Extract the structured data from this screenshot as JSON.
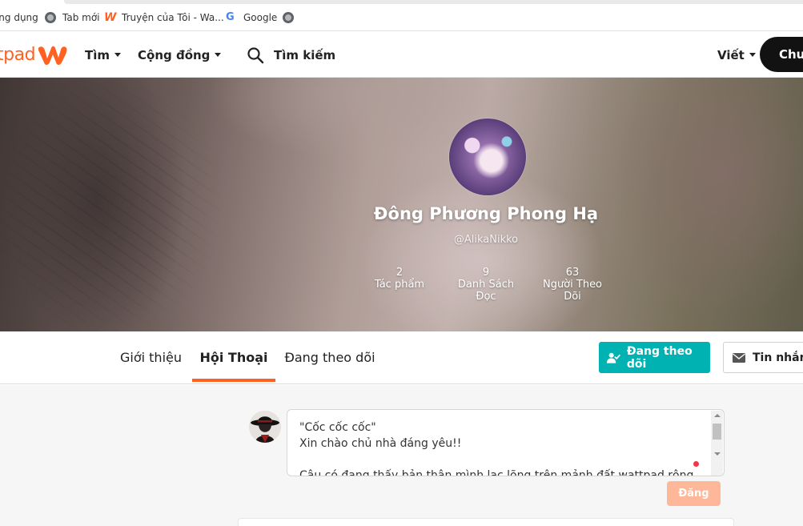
{
  "bookmarks": [
    {
      "label": "Ứng dụng",
      "icon": "apps-icon"
    },
    {
      "label": "Tab mới",
      "icon": "globe-icon"
    },
    {
      "label": "Truyện của Tôi - Wa...",
      "icon": "wattpad-icon"
    },
    {
      "label": "Google",
      "icon": "google-icon"
    },
    {
      "label": "",
      "icon": "globe-icon"
    }
  ],
  "header": {
    "logo_text": "tpad",
    "nav": {
      "browse": "Tìm",
      "community": "Cộng đồng"
    },
    "search_placeholder": "Tìm kiếm",
    "write": "Viết",
    "premium": "Chuy"
  },
  "profile": {
    "display_name": "Đông Phương Phong Hạ",
    "username": "@AlikaNikko",
    "stats": [
      {
        "value": "2",
        "label": "Tác phẩm"
      },
      {
        "value": "9",
        "label": "Danh Sách Đọc"
      },
      {
        "value": "63",
        "label": "Người Theo Dõi"
      }
    ]
  },
  "tabs": {
    "about": "Giới thiệu",
    "conversations": "Hội Thoại",
    "following": "Đang theo dõi",
    "active": "conversations"
  },
  "actions": {
    "following_button": "Đang theo dõi",
    "message_button": "Tin nhắn"
  },
  "composer": {
    "text": "\"Cốc cốc cốc\"\nXin chào chủ nhà đáng yêu!!\n\nCậu có đang thấy bản thân mình lạc lõng trên mảnh đất wattpad rộng lớn",
    "post_button": "Đăng"
  },
  "colors": {
    "brand": "#ff6122",
    "follow": "#00b2b2",
    "post_disabled": "#ffb79a"
  }
}
